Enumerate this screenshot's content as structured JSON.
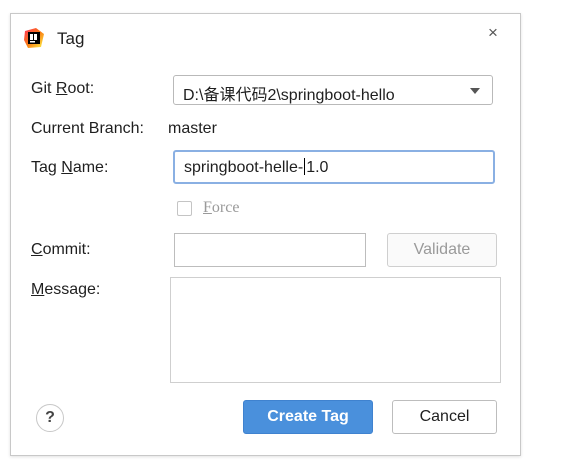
{
  "dialog": {
    "title": "Tag",
    "close_symbol": "×",
    "icon": "intellij-idea-icon"
  },
  "git_root": {
    "label_pre": "Git ",
    "label_mnemonic": "R",
    "label_post": "oot:",
    "value": "D:\\备课代码2\\springboot-hello"
  },
  "current_branch": {
    "label": "Current Branch:",
    "value": "master"
  },
  "tag_name": {
    "label_pre": "Tag ",
    "label_mnemonic": "N",
    "label_post": "ame:",
    "value_before_caret": "springboot-helle-",
    "value_after_caret": "1.0"
  },
  "force": {
    "label_mnemonic": "F",
    "label_post": "orce",
    "checked": false
  },
  "commit": {
    "label_mnemonic": "C",
    "label_post": "ommit:",
    "value": "",
    "validate_label": "Validate"
  },
  "message": {
    "label_mnemonic": "M",
    "label_post": "essage:",
    "value": ""
  },
  "footer": {
    "help_label": "?",
    "create_label": "Create Tag",
    "cancel_label": "Cancel"
  },
  "colors": {
    "primary_button": "#4a90dc",
    "focus_border": "#8ab0e3"
  }
}
